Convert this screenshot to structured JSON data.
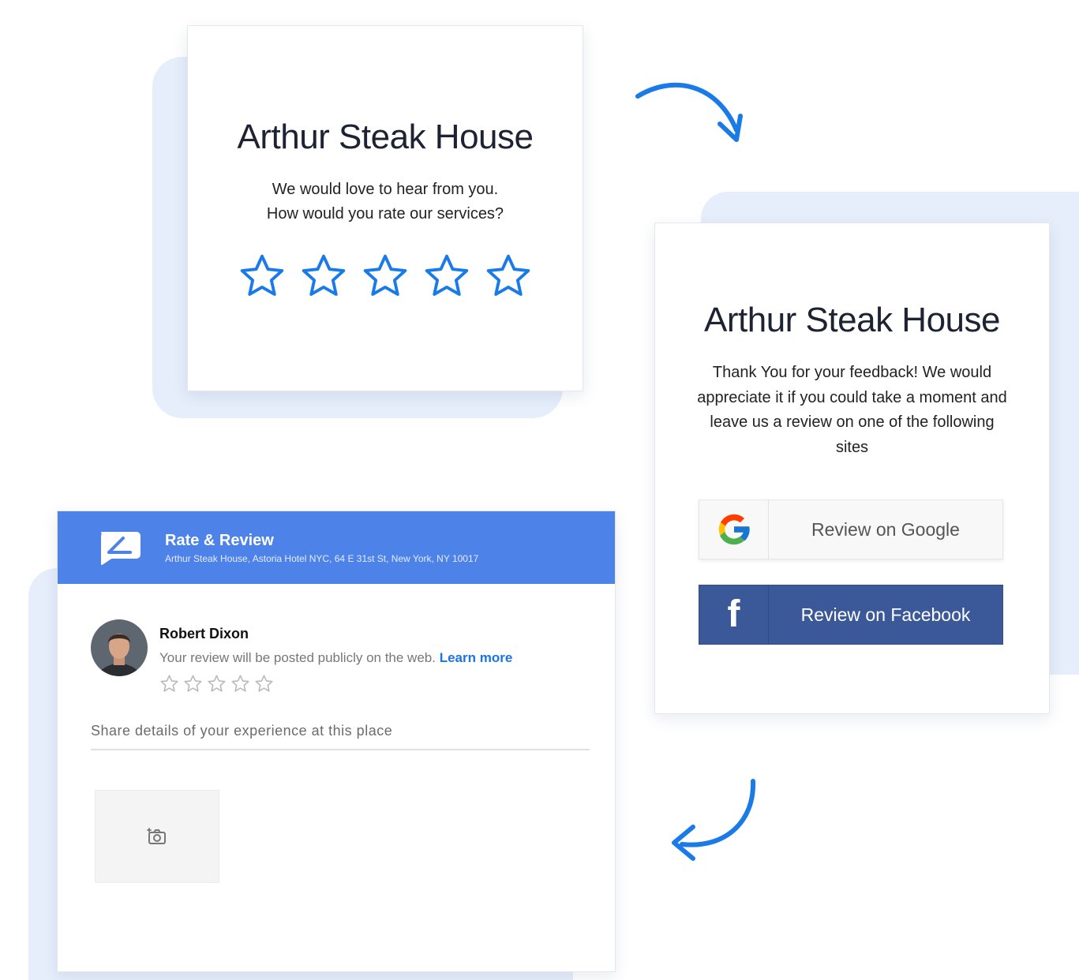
{
  "rating_card": {
    "title": "Arthur Steak House",
    "prompt_line1": "We would love to hear from you.",
    "prompt_line2": "How would you rate our services?",
    "star_count": 5,
    "star_color": "#1a7be8"
  },
  "review_sites_card": {
    "title": "Arthur Steak House",
    "message": "Thank You for your feedback! We would appreciate it if you could take a moment and leave us a review on one of the following sites",
    "google_button_label": "Review on Google",
    "google_icon": "google-g-icon",
    "facebook_button_label": "Review on Facebook",
    "facebook_icon": "facebook-f-icon",
    "facebook_color": "#3b5998"
  },
  "review_form": {
    "header_title": "Rate & Review",
    "header_address": "Arthur Steak House, Astoria Hotel NYC, 64 E 31st St, New York, NY 10017",
    "header_color": "#4d82e8",
    "reviewer_name": "Robert Dixon",
    "public_note": "Your review will be posted publicly on the web.",
    "learn_more": "Learn more",
    "star_count": 5,
    "details_placeholder": "Share details of your experience at this place",
    "photo_icon": "add-photo-icon"
  },
  "accent_color": "#1a7be8"
}
